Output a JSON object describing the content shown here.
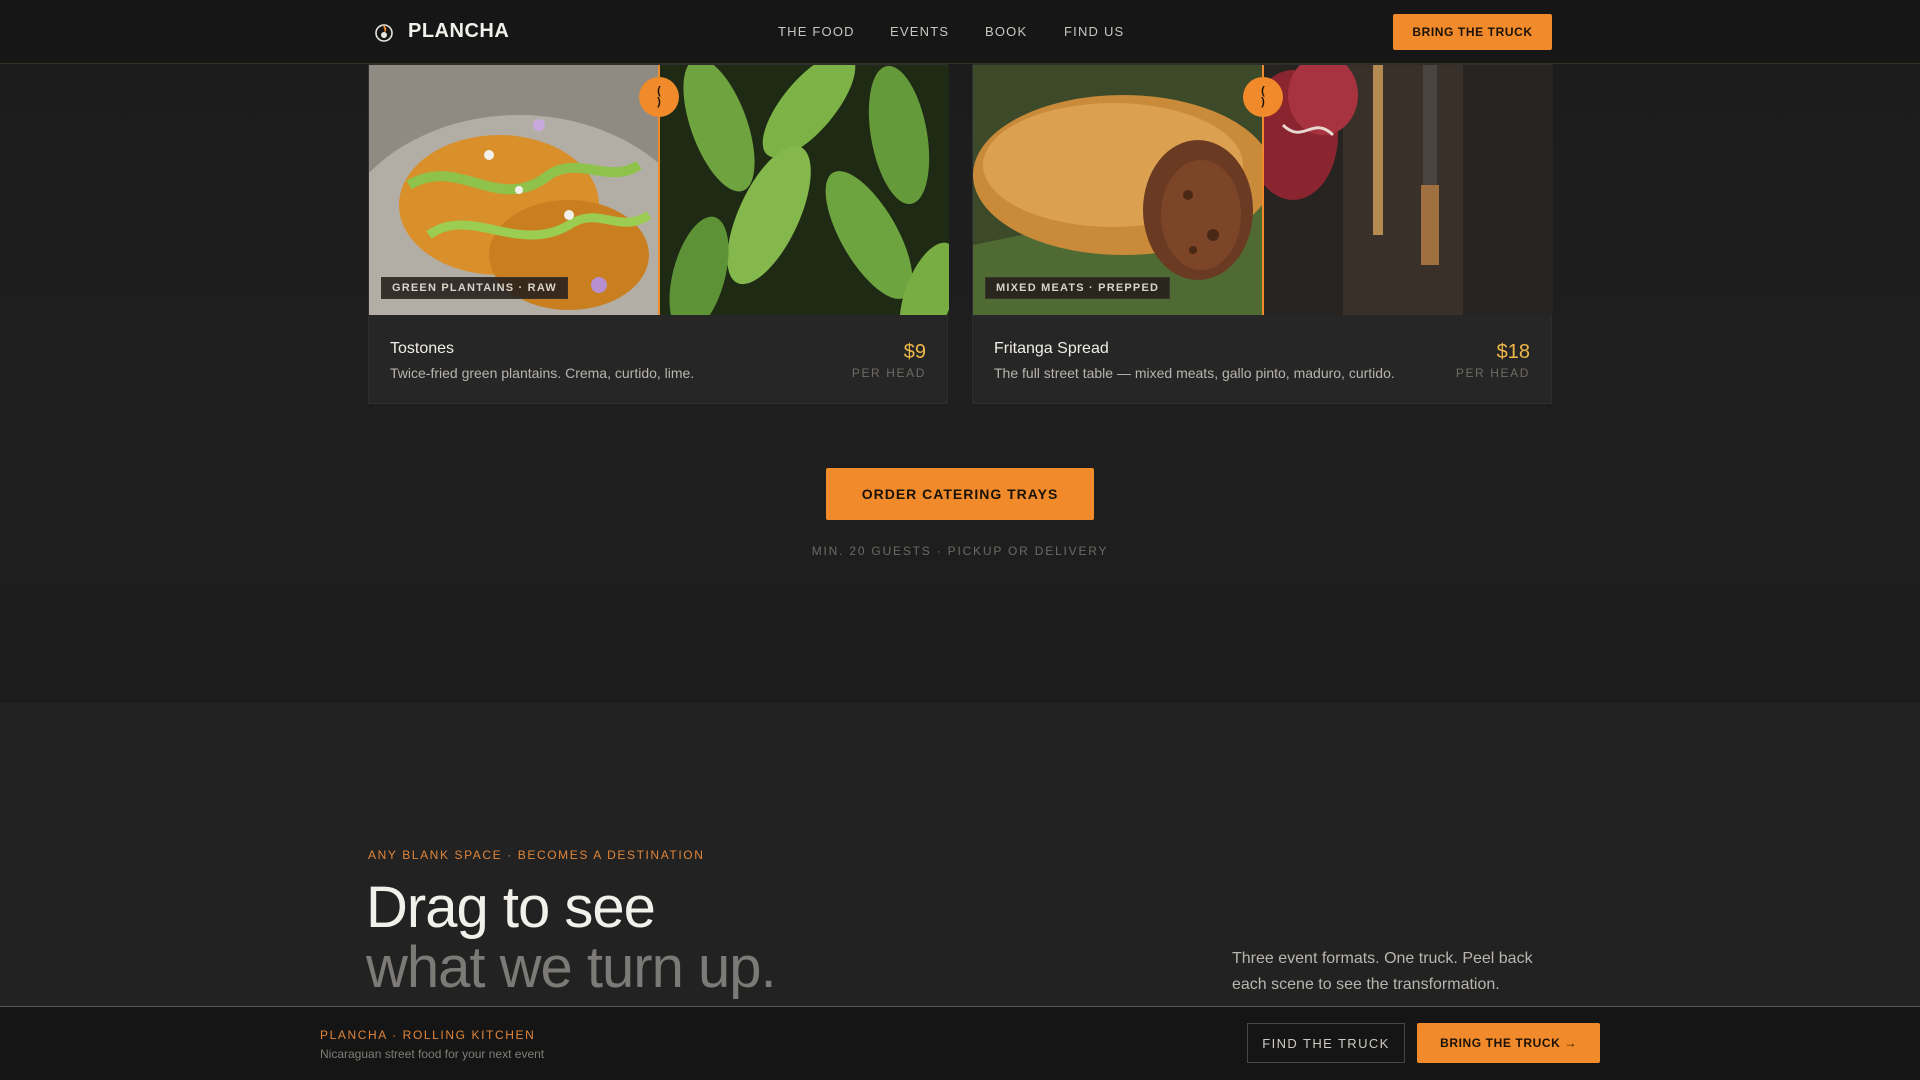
{
  "header": {
    "brand": "PLANCHA",
    "nav": [
      "THE FOOD",
      "EVENTS",
      "BOOK",
      "FIND US"
    ],
    "cta": "BRING THE TRUCK"
  },
  "cards": [
    {
      "tag": "GREEN PLANTAINS · RAW",
      "name": "Tostones",
      "description": "Twice-fried green plantains. Crema, curtido, lime.",
      "price": "$9",
      "unit": "PER HEAD"
    },
    {
      "tag": "MIXED MEATS · PREPPED",
      "name": "Fritanga Spread",
      "description": "The full street table — mixed meats, gallo pinto, maduro, curtido.",
      "price": "$18",
      "unit": "PER HEAD"
    }
  ],
  "catering": {
    "button": "ORDER CATERING TRAYS",
    "note": "MIN. 20 GUESTS · PICKUP OR DELIVERY"
  },
  "destination": {
    "eyebrow": "ANY BLANK SPACE · BECOMES A DESTINATION",
    "headline_line1": "Drag to see",
    "headline_line2": "what we turn up.",
    "copy": "Three event formats. One truck. Peel back each scene to see the transformation."
  },
  "footer": {
    "brand": "PLANCHA · ROLLING KITCHEN",
    "subtitle": "Nicaraguan street food for your next event",
    "find_button": "FIND THE TRUCK",
    "bring_button": "BRING THE TRUCK →"
  },
  "colors": {
    "accent": "#f08a2a",
    "price": "#f0b84a",
    "background": "#1a1a1a"
  },
  "icons": {
    "logo": "flame-pan-icon",
    "slider_handle": "compare-slider-handle-icon"
  }
}
